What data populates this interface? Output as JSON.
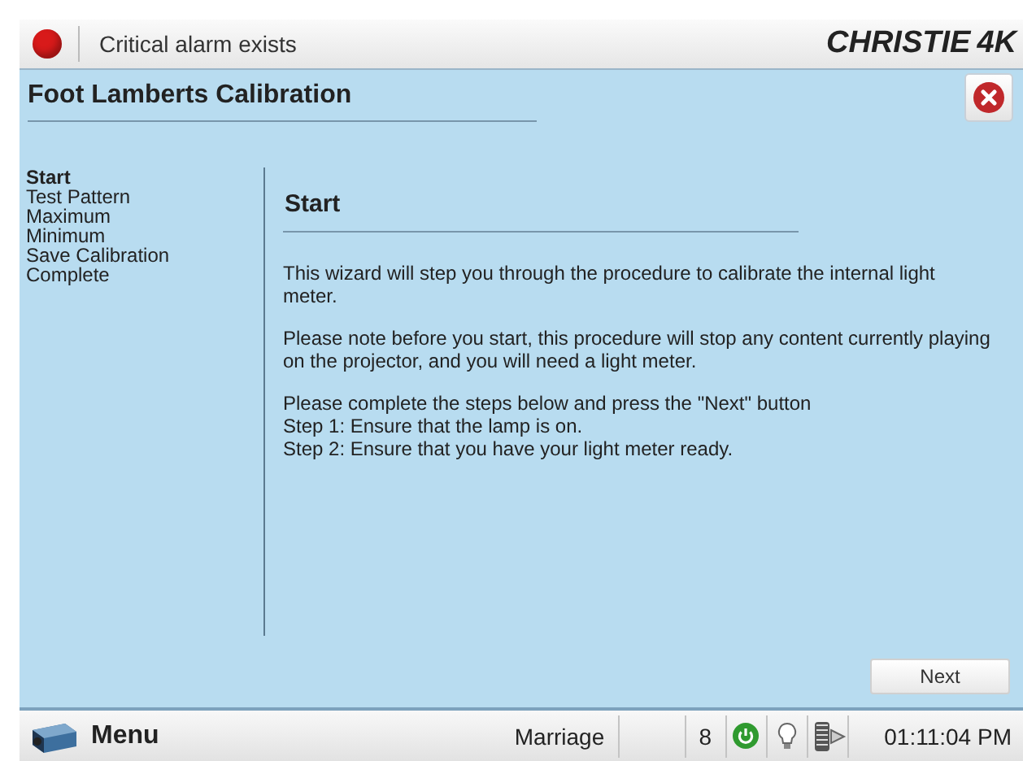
{
  "alarm": {
    "text": "Critical alarm exists",
    "color": "#d81a1a"
  },
  "logo": {
    "brand": "CHRISTIE",
    "suffix": "4K"
  },
  "window": {
    "title": "Foot Lamberts Calibration"
  },
  "steps": [
    {
      "label": "Start",
      "selected": true
    },
    {
      "label": "Test Pattern",
      "selected": false
    },
    {
      "label": "Maximum",
      "selected": false
    },
    {
      "label": "Minimum",
      "selected": false
    },
    {
      "label": "Save Calibration",
      "selected": false
    },
    {
      "label": "Complete",
      "selected": false
    }
  ],
  "page": {
    "heading": "Start",
    "paragraphs": [
      "This wizard will step you through the procedure to calibrate the internal light meter.",
      "Please note before you start, this procedure will stop any content currently playing on the projector, and you will need a light meter.",
      "Please complete the steps below and press the \"Next\" button\nStep 1: Ensure that the lamp is on.\nStep 2: Ensure that you have your light meter ready."
    ]
  },
  "buttons": [
    "Next"
  ],
  "status_bar": {
    "menu": "Menu",
    "channel": "Marriage",
    "number": "8",
    "power_on": true,
    "time": "01:11:04 PM"
  }
}
